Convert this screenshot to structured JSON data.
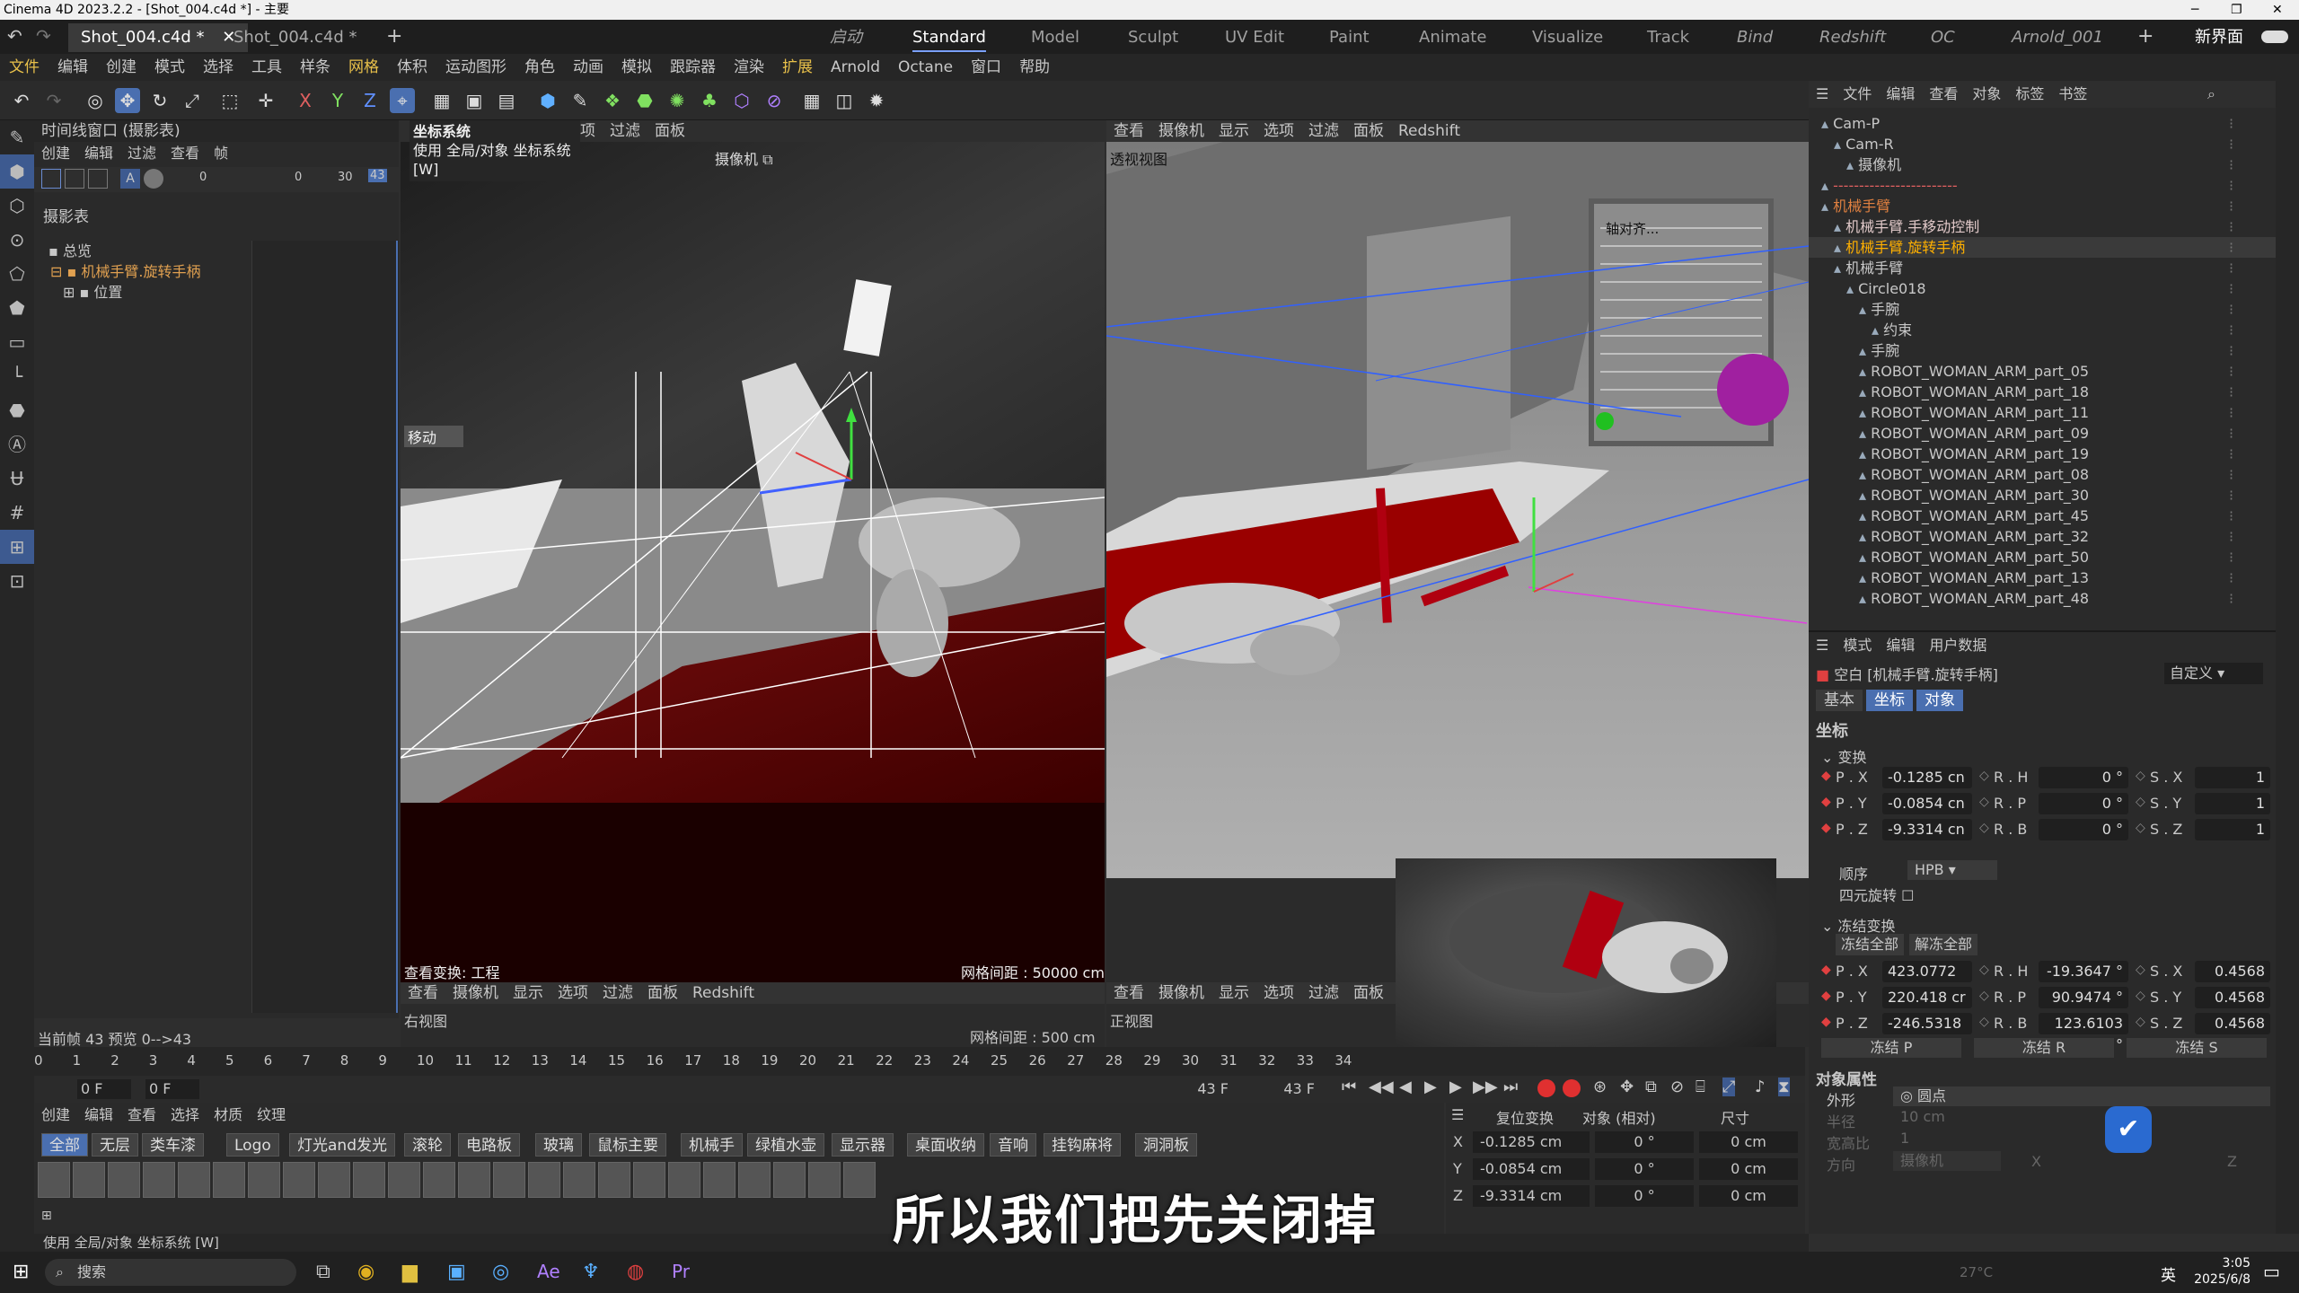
{
  "titlebar": {
    "title": "Cinema 4D 2023.2.2 - [Shot_004.c4d *] - 主要"
  },
  "tabs": {
    "doc1": "Shot_004.c4d *",
    "doc2": "Shot_004.c4d *",
    "add": "+"
  },
  "layouts": [
    "启动",
    "Standard",
    "Model",
    "Sculpt",
    "UV Edit",
    "Paint",
    "Animate",
    "Visualize",
    "Track",
    "Bind",
    "Redshift",
    "OC",
    "Arnold_001"
  ],
  "new_layout": "新界面",
  "menu": [
    "文件",
    "编辑",
    "创建",
    "模式",
    "选择",
    "工具",
    "样条",
    "网格",
    "体积",
    "运动图形",
    "角色",
    "动画",
    "模拟",
    "跟踪器",
    "渲染",
    "扩展",
    "Arnold",
    "Octane",
    "窗口",
    "帮助"
  ],
  "timeline": {
    "title": "时间线窗口 (摄影表)",
    "menu": [
      "创建",
      "编辑",
      "过滤",
      "查看",
      "帧"
    ],
    "section": "摄影表",
    "tracks": [
      "总览",
      "机械手臂.旋转手柄",
      "位置"
    ],
    "ticks": [
      "0",
      "0",
      "30",
      "43"
    ]
  },
  "tooltip": {
    "title": "坐标系统",
    "desc": "使用 全局/对象 坐标系统",
    "key": "[W]"
  },
  "vp_tl": {
    "menu": [
      "项",
      "过滤",
      "面板"
    ],
    "camera": "摄像机",
    "move_label": "移动",
    "status_left": "查看变换: 工程",
    "grid": "网格间距 : 50000 cm"
  },
  "vp_bl": {
    "menu": [
      "查看",
      "摄像机",
      "显示",
      "选项",
      "过滤",
      "面板",
      "Redshift"
    ],
    "name": "右视图",
    "grid": "网格间距 : 500 cm"
  },
  "vp_tr": {
    "menu": [
      "查看",
      "摄像机",
      "显示",
      "选项",
      "过滤",
      "面板",
      "Redshift"
    ],
    "name": "透视视图",
    "align_label": "轴对齐..."
  },
  "vp_br": {
    "menu": [
      "查看",
      "摄像机",
      "显示",
      "选项",
      "过滤",
      "面板",
      "Re"
    ],
    "name": "正视图"
  },
  "frame_info": {
    "current": "当前帧 43 预览 0-->43"
  },
  "ruler": [
    "0",
    "1",
    "2",
    "3",
    "4",
    "5",
    "6",
    "7",
    "8",
    "9",
    "10",
    "11",
    "12",
    "13",
    "14",
    "15",
    "16",
    "17",
    "18",
    "19",
    "20",
    "21",
    "22",
    "23",
    "24",
    "25",
    "26",
    "27",
    "28",
    "29",
    "30",
    "31",
    "32",
    "33",
    "34"
  ],
  "transport": {
    "f1": "0 F",
    "f2": "0 F",
    "f3": "43 F",
    "f4": "43 F"
  },
  "material": {
    "menu": [
      "创建",
      "编辑",
      "查看",
      "选择",
      "材质",
      "纹理"
    ],
    "tabs": [
      "全部",
      "无层",
      "类车漆",
      "Logo",
      "灯光and发光",
      "滚轮",
      "电路板",
      "玻璃",
      "鼠标主要",
      "机械手",
      "绿植水壶",
      "显示器",
      "桌面收纳",
      "音响",
      "挂钩麻将",
      "洞洞板"
    ]
  },
  "coords": {
    "reset": "复位变换",
    "mode": "对象 (相对)",
    "size": "尺寸",
    "rows": [
      {
        "axis": "X",
        "pos": "-0.1285 cm",
        "rot": "0 °",
        "size": "0 cm"
      },
      {
        "axis": "Y",
        "pos": "-0.0854 cm",
        "rot": "0 °",
        "size": "0 cm"
      },
      {
        "axis": "Z",
        "pos": "-9.3314 cm",
        "rot": "0 °",
        "size": "0 cm"
      }
    ]
  },
  "objmgr": {
    "menu": [
      "文件",
      "编辑",
      "查看",
      "对象",
      "标签",
      "书签"
    ],
    "items": [
      {
        "label": "Cam-P",
        "indent": 0,
        "color": "#c8c8c8"
      },
      {
        "label": "Cam-R",
        "indent": 1,
        "color": "#c8c8c8"
      },
      {
        "label": "摄像机",
        "indent": 2,
        "color": "#c8c8c8"
      },
      {
        "label": "------------------------",
        "indent": 0,
        "color": "#e06060"
      },
      {
        "label": "机械手臂",
        "indent": 0,
        "color": "#e08040"
      },
      {
        "label": "机械手臂.手移动控制",
        "indent": 1,
        "color": "#e0c8c8"
      },
      {
        "label": "机械手臂.旋转手柄",
        "indent": 1,
        "color": "#ffb000"
      },
      {
        "label": "机械手臂",
        "indent": 1,
        "color": "#c8c8c8"
      },
      {
        "label": "Circle018",
        "indent": 2,
        "color": "#c8c8c8"
      },
      {
        "label": "手腕",
        "indent": 3,
        "color": "#c8c8c8"
      },
      {
        "label": "约束",
        "indent": 4,
        "color": "#c8c8c8"
      },
      {
        "label": "手腕",
        "indent": 3,
        "color": "#c8c8c8"
      },
      {
        "label": "ROBOT_WOMAN_ARM_part_05",
        "indent": 3,
        "color": "#c8c8c8"
      },
      {
        "label": "ROBOT_WOMAN_ARM_part_18",
        "indent": 3,
        "color": "#c8c8c8"
      },
      {
        "label": "ROBOT_WOMAN_ARM_part_11",
        "indent": 3,
        "color": "#c8c8c8"
      },
      {
        "label": "ROBOT_WOMAN_ARM_part_09",
        "indent": 3,
        "color": "#c8c8c8"
      },
      {
        "label": "ROBOT_WOMAN_ARM_part_19",
        "indent": 3,
        "color": "#c8c8c8"
      },
      {
        "label": "ROBOT_WOMAN_ARM_part_08",
        "indent": 3,
        "color": "#c8c8c8"
      },
      {
        "label": "ROBOT_WOMAN_ARM_part_30",
        "indent": 3,
        "color": "#c8c8c8"
      },
      {
        "label": "ROBOT_WOMAN_ARM_part_45",
        "indent": 3,
        "color": "#c8c8c8"
      },
      {
        "label": "ROBOT_WOMAN_ARM_part_32",
        "indent": 3,
        "color": "#c8c8c8"
      },
      {
        "label": "ROBOT_WOMAN_ARM_part_50",
        "indent": 3,
        "color": "#c8c8c8"
      },
      {
        "label": "ROBOT_WOMAN_ARM_part_13",
        "indent": 3,
        "color": "#c8c8c8"
      },
      {
        "label": "ROBOT_WOMAN_ARM_part_48",
        "indent": 3,
        "color": "#c8c8c8"
      }
    ]
  },
  "attr": {
    "menu": [
      "模式",
      "编辑",
      "用户数据"
    ],
    "object": "空白 [机械手臂.旋转手柄]",
    "preset": "自定义",
    "tabs": [
      "基本",
      "坐标",
      "对象"
    ],
    "section": "坐标",
    "transform": "变换",
    "p": [
      {
        "l": "P . X",
        "v": "-0.1285 cn"
      },
      {
        "l": "P . Y",
        "v": "-0.0854 cn"
      },
      {
        "l": "P . Z",
        "v": "-9.3314 cn"
      }
    ],
    "r": [
      {
        "l": "R . H",
        "v": "0 °"
      },
      {
        "l": "R . P",
        "v": "0 °"
      },
      {
        "l": "R . B",
        "v": "0 °"
      }
    ],
    "s": [
      {
        "l": "S . X",
        "v": "1"
      },
      {
        "l": "S . Y",
        "v": "1"
      },
      {
        "l": "S . Z",
        "v": "1"
      }
    ],
    "order_label": "顺序",
    "order": "HPB",
    "quat": "四元旋转",
    "frozen": "冻结变换",
    "freeze_all": "冻结全部",
    "unfreeze_all": "解冻全部",
    "fp": [
      {
        "l": "P . X",
        "v": "423.0772 c"
      },
      {
        "l": "P . Y",
        "v": "220.418 cr"
      },
      {
        "l": "P . Z",
        "v": "-246.5318"
      }
    ],
    "fr": [
      {
        "l": "R . H",
        "v": "-19.3647 °"
      },
      {
        "l": "R . P",
        "v": "90.9474 °"
      },
      {
        "l": "R . B",
        "v": "123.6103 °"
      }
    ],
    "fs": [
      {
        "l": "S . X",
        "v": "0.4568"
      },
      {
        "l": "S . Y",
        "v": "0.4568"
      },
      {
        "l": "S . Z",
        "v": "0.4568"
      }
    ],
    "freeze_p": "冻结 P",
    "freeze_r": "冻结 R",
    "freeze_s": "冻结 S",
    "objprops": "对象属性",
    "shape_label": "外形",
    "shape": "圆点",
    "radius_label": "半径",
    "radius": "10 cm",
    "aspect_label": "宽高比",
    "aspect": "1",
    "dir_label": "方向",
    "dir": "摄像机",
    "dir_x": "X",
    "dir_z": "Z"
  },
  "statusbar": "使用 全局/对象 坐标系统 [W]",
  "subtitle": "所以我们把先关闭掉",
  "taskbar": {
    "search": "搜索",
    "time": "3:05",
    "date": "2025/6/8",
    "lang": "英",
    "temp": "27°C"
  }
}
